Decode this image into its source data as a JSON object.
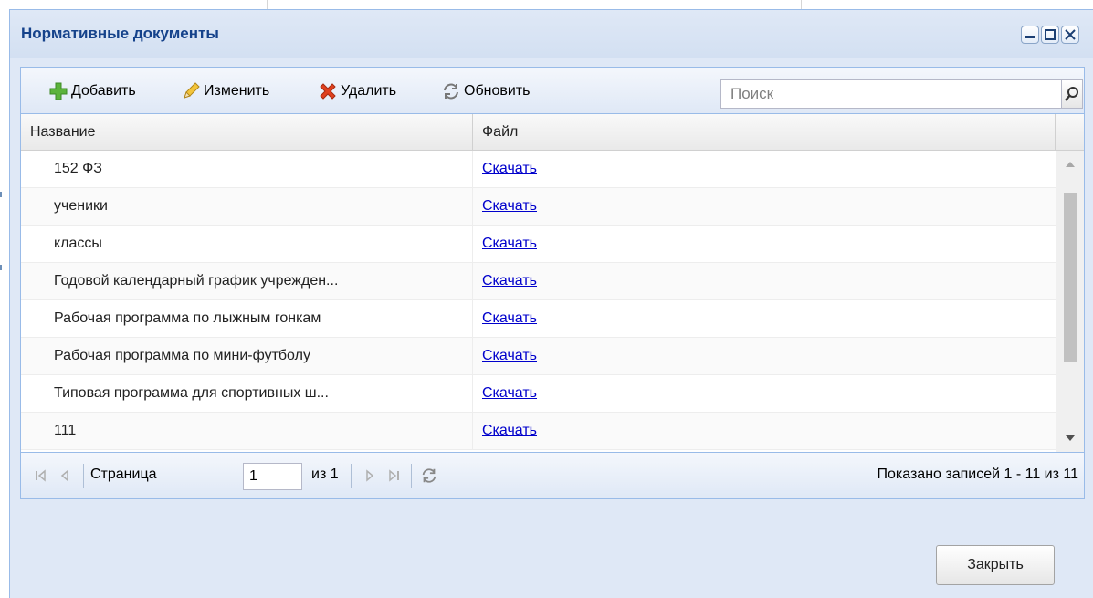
{
  "window": {
    "title": "Нормативные документы",
    "tools": [
      "minimize-icon",
      "maximize-icon",
      "close-icon"
    ]
  },
  "toolbar": {
    "add_label": "Добавить",
    "edit_label": "Изменить",
    "delete_label": "Удалить",
    "refresh_label": "Обновить",
    "search_placeholder": "Поиск"
  },
  "grid": {
    "columns": [
      "Название",
      "Файл"
    ],
    "rows": [
      {
        "name": "152 ФЗ",
        "file": "Скачать"
      },
      {
        "name": "ученики",
        "file": "Скачать"
      },
      {
        "name": "классы",
        "file": "Скачать"
      },
      {
        "name": "Годовой календарный график учрежден...",
        "file": "Скачать"
      },
      {
        "name": "Рабочая программа по лыжным гонкам",
        "file": "Скачать"
      },
      {
        "name": "Рабочая программа по мини-футболу",
        "file": "Скачать"
      },
      {
        "name": "Типовая программа для спортивных ш...",
        "file": "Скачать"
      },
      {
        "name": "111",
        "file": "Скачать"
      }
    ]
  },
  "paging": {
    "page_label": "Страница",
    "page_value": "1",
    "of_label": "из 1",
    "summary": "Показано записей 1 - 11 из 11"
  },
  "footer": {
    "close_label": "Закрыть"
  },
  "colors": {
    "header_bg": "#dfe8f6",
    "title_text": "#15428b",
    "border": "#99bbe8",
    "link": "#0000cc"
  }
}
